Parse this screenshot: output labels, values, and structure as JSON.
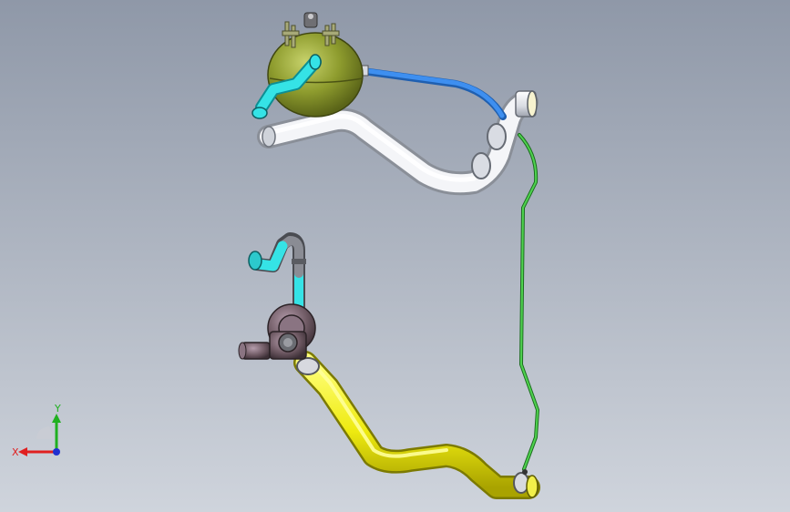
{
  "viewport": {
    "background_top": "#8f98a8",
    "background_bottom": "#cfd4dc"
  },
  "colors": {
    "tank": "#8e9c2e",
    "tank_highlight": "#c3cf6a",
    "upper_hose": "#e3e6ec",
    "blue_hose": "#2f7fe0",
    "cyan_fitting": "#29d3d6",
    "green_line": "#37b43a",
    "yellow_hose": "#f0ee17",
    "pump": "#6f5a64",
    "gray_fitting": "#70727a"
  },
  "triad": {
    "x_label": "X",
    "y_label": "Y",
    "x_color": "#e02020",
    "y_color": "#20b020",
    "z_color": "#2030d0"
  },
  "parts": {
    "tank_icon": "expansion-tank",
    "pump_icon": "coolant-pump"
  }
}
